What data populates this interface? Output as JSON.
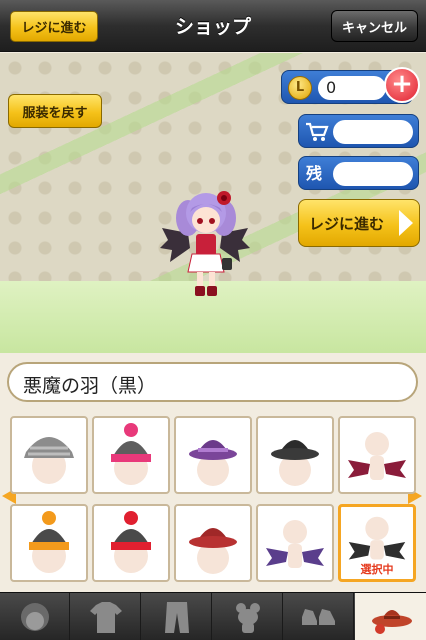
{
  "header": {
    "title": "ショップ",
    "register_label": "レジに進む",
    "cancel_label": "キャンセル"
  },
  "stage": {
    "restore_label": "服装を戻す",
    "coin_icon_letter": "L",
    "coin_value": "0",
    "remaining_label": "残",
    "register_big_label": "レジに進む"
  },
  "item": {
    "name": "悪魔の羽（黒）"
  },
  "grid": {
    "selected_label": "選択中"
  },
  "tabs": [
    "face-icon",
    "shirt-icon",
    "pants-icon",
    "accessory-icon",
    "shoes-icon",
    "hat-icon"
  ],
  "colors": {
    "accent_yellow": "#f5c21a",
    "accent_blue": "#2a66c2",
    "selected_orange": "#f5a623",
    "plus_red": "#e02030"
  }
}
